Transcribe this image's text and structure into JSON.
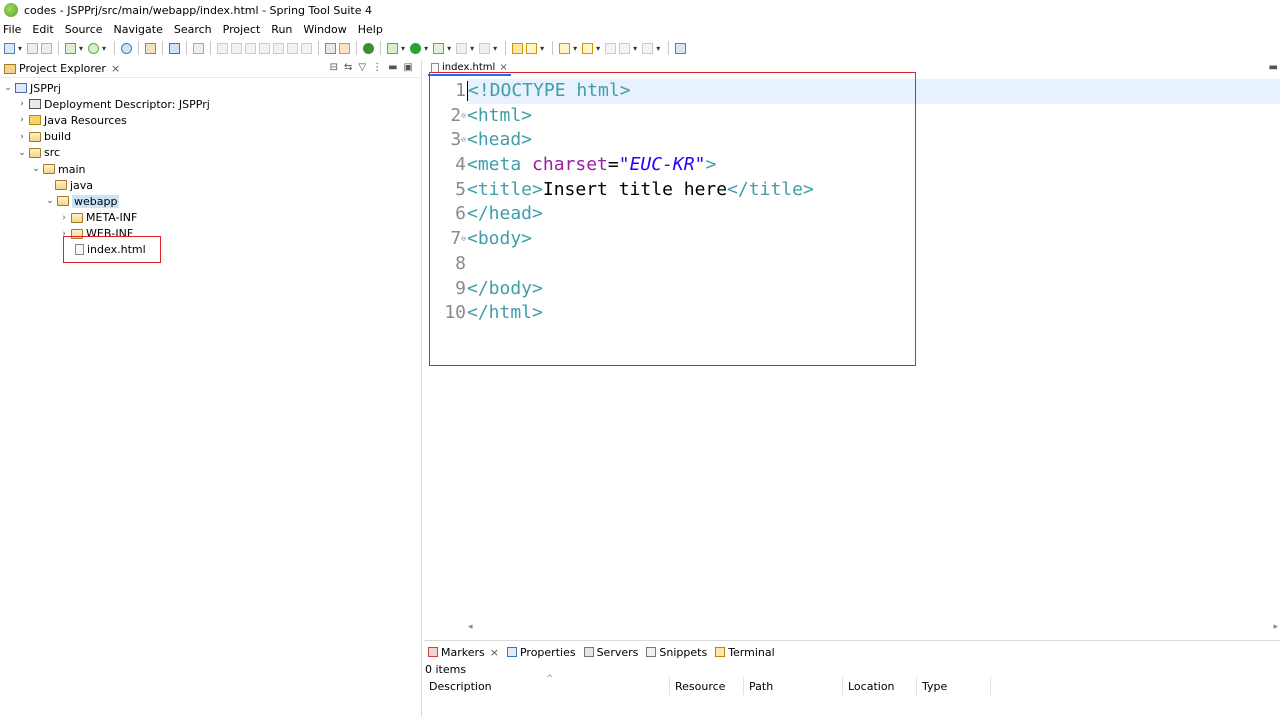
{
  "window": {
    "title": "codes - JSPPrj/src/main/webapp/index.html - Spring Tool Suite 4"
  },
  "menu": [
    "File",
    "Edit",
    "Source",
    "Navigate",
    "Search",
    "Project",
    "Run",
    "Window",
    "Help"
  ],
  "explorer": {
    "tab_label": "Project Explorer",
    "close_glyph": "×",
    "tree": [
      {
        "label": "JSPPrj",
        "depth": 0,
        "chevron": "expanded",
        "icon": "project-icon"
      },
      {
        "label": "Deployment Descriptor: JSPPrj",
        "depth": 1,
        "chevron": "collapsed",
        "icon": "deployment-descriptor-icon"
      },
      {
        "label": "Java Resources",
        "depth": 1,
        "chevron": "collapsed",
        "icon": "java-resources-icon"
      },
      {
        "label": "build",
        "depth": 1,
        "chevron": "collapsed",
        "icon": "folder-icon"
      },
      {
        "label": "src",
        "depth": 1,
        "chevron": "expanded",
        "icon": "folder-icon"
      },
      {
        "label": "main",
        "depth": 2,
        "chevron": "expanded",
        "icon": "folder-icon"
      },
      {
        "label": "java",
        "depth": 3,
        "chevron": "none",
        "icon": "folder-icon"
      },
      {
        "label": "webapp",
        "depth": 3,
        "chevron": "expanded",
        "icon": "folder-icon",
        "selected": true
      },
      {
        "label": "META-INF",
        "depth": 4,
        "chevron": "collapsed",
        "icon": "folder-icon"
      },
      {
        "label": "WEB-INF",
        "depth": 4,
        "chevron": "collapsed",
        "icon": "folder-icon"
      },
      {
        "label": "index.html",
        "depth": 4,
        "chevron": "none",
        "icon": "html-file-icon"
      }
    ]
  },
  "editor": {
    "tab_label": "index.html",
    "close_glyph": "×",
    "lines": [
      {
        "num": "1",
        "fold": "",
        "current": true
      },
      {
        "num": "2",
        "fold": "⊖"
      },
      {
        "num": "3",
        "fold": "⊖"
      },
      {
        "num": "4",
        "fold": ""
      },
      {
        "num": "5",
        "fold": ""
      },
      {
        "num": "6",
        "fold": ""
      },
      {
        "num": "7",
        "fold": "⊖"
      },
      {
        "num": "8",
        "fold": ""
      },
      {
        "num": "9",
        "fold": ""
      },
      {
        "num": "10",
        "fold": ""
      }
    ],
    "code": {
      "l1": "<!DOCTYPE html>",
      "l2": "<html>",
      "l3": "<head>",
      "l4_open": "<meta ",
      "l4_attr": "charset",
      "l4_eq": "=",
      "l4_val": "\"EUC-KR\"",
      "l4_close": ">",
      "l5_open": "<title>",
      "l5_text": "Insert title here",
      "l5_close": "</title>",
      "l6": "</head>",
      "l7": "<body>",
      "l8": "",
      "l9": "</body>",
      "l10": "</html>"
    }
  },
  "bottom_panel": {
    "tabs": [
      {
        "label": "Markers",
        "icon": "markers-icon",
        "active": true
      },
      {
        "label": "Properties",
        "icon": "properties-icon"
      },
      {
        "label": "Servers",
        "icon": "servers-icon"
      },
      {
        "label": "Snippets",
        "icon": "snippets-icon"
      },
      {
        "label": "Terminal",
        "icon": "terminal-icon"
      }
    ],
    "close_glyph": "×",
    "item_count": "0 items",
    "columns": [
      "Description",
      "Resource",
      "Path",
      "Location",
      "Type"
    ]
  },
  "colors": {
    "tag": "#3f9eaa",
    "attribute": "#9b1da2",
    "value": "#2a00ff",
    "highlight_box": "#e0202a",
    "selection": "#cce4f7",
    "current_line": "#e8f2fe"
  }
}
